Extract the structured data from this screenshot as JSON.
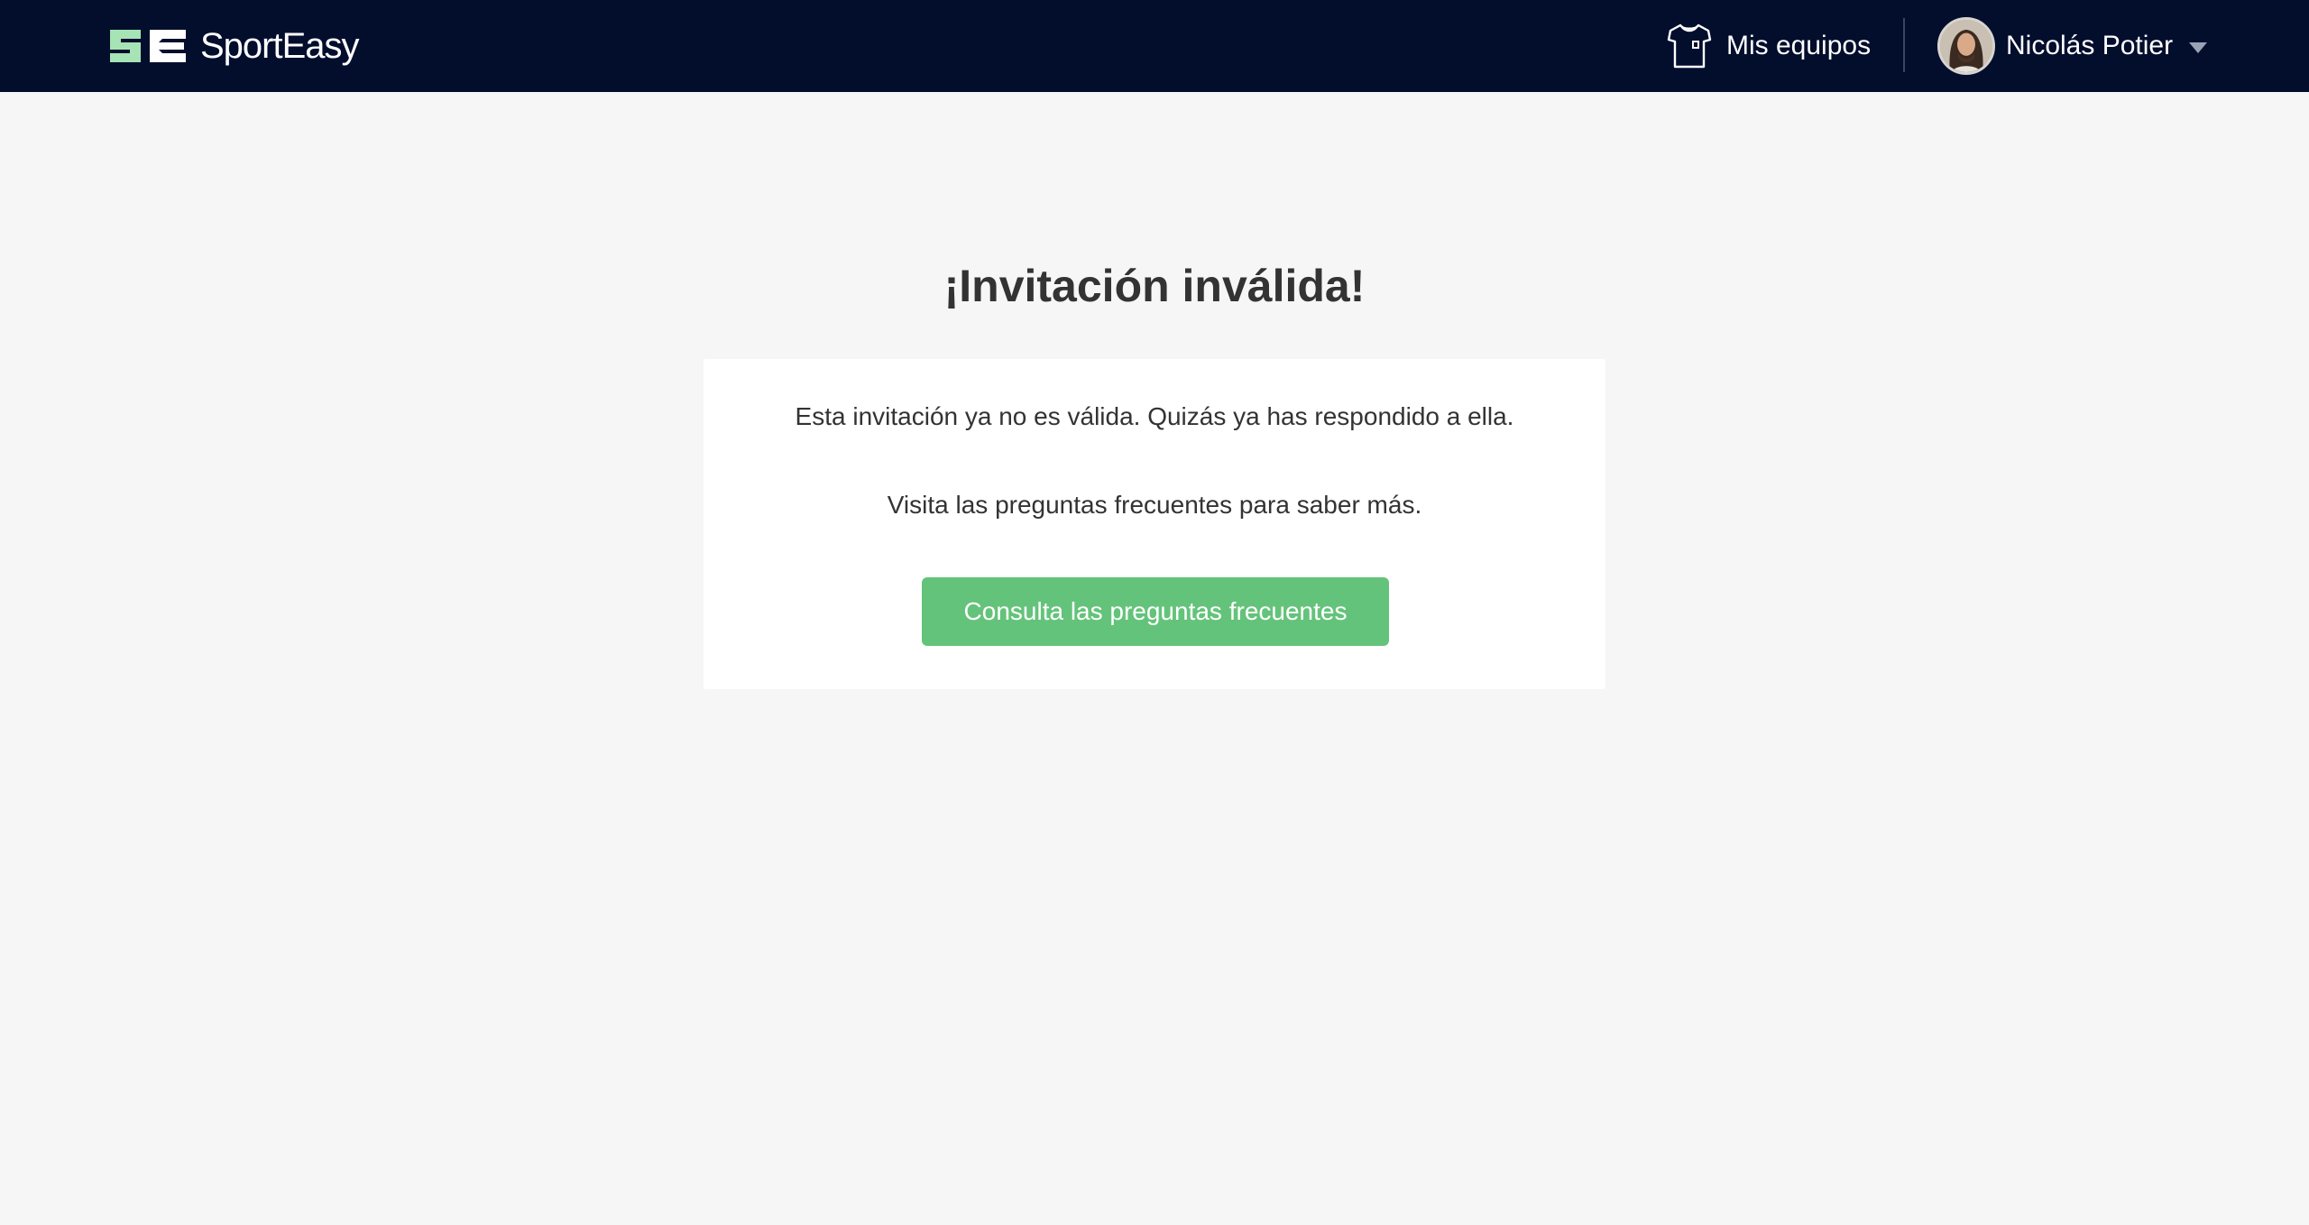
{
  "header": {
    "brand": "SportEasy",
    "logo_mark_icon": "sporteasy-se-logo-icon",
    "teams_icon": "jersey-icon",
    "teams_label": "Mis equipos",
    "user_name": "Nicolás Potier",
    "dropdown_icon": "caret-down-icon"
  },
  "main": {
    "title": "¡Invitación inválida!",
    "message": "Esta invitación ya no es válida. Quizás ya has respondido a ella.",
    "help_text": "Visita las preguntas frecuentes para saber más.",
    "faq_button_label": "Consulta las preguntas frecuentes"
  },
  "colors": {
    "header_bg": "#030e2d",
    "page_bg": "#f6f6f6",
    "logo_green": "#a6e3b5",
    "button_green": "#64c37a",
    "text": "#333333"
  }
}
